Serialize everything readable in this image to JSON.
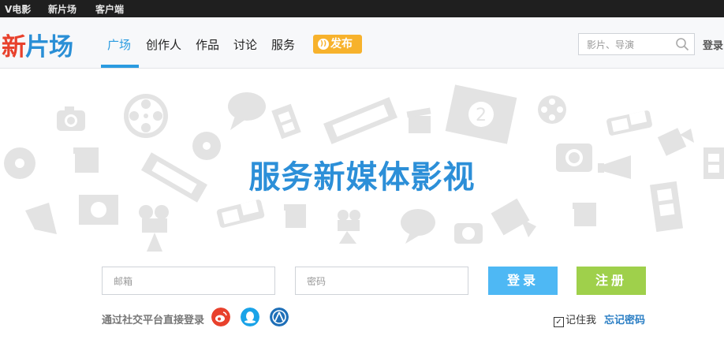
{
  "topbar": {
    "links": [
      "V电影",
      "新片场",
      "客户端"
    ]
  },
  "header": {
    "logo_part1": "新",
    "logo_part2": "片场",
    "nav": [
      "广场",
      "创作人",
      "作品",
      "讨论",
      "服务"
    ],
    "publish_label": "发布",
    "search_placeholder": "影片、导演",
    "login_label": "登录"
  },
  "banner": {
    "slogan": "服务新媒体影视"
  },
  "login_form": {
    "email_placeholder": "邮箱",
    "password_placeholder": "密码",
    "login_button": "登录",
    "register_button": "注册",
    "social_label": "通过社交平台直接登录",
    "social_icons": [
      "weibo-icon",
      "qq-icon",
      "renren-icon"
    ],
    "remember_label": "记住我",
    "remember_checked": true,
    "forgot_label": "忘记密码"
  },
  "colors": {
    "brand_blue": "#2a9be0",
    "logo_red": "#e8412c",
    "publish_orange": "#f7b22c",
    "login_blue": "#4eb8f4",
    "register_green": "#9fd04b"
  }
}
